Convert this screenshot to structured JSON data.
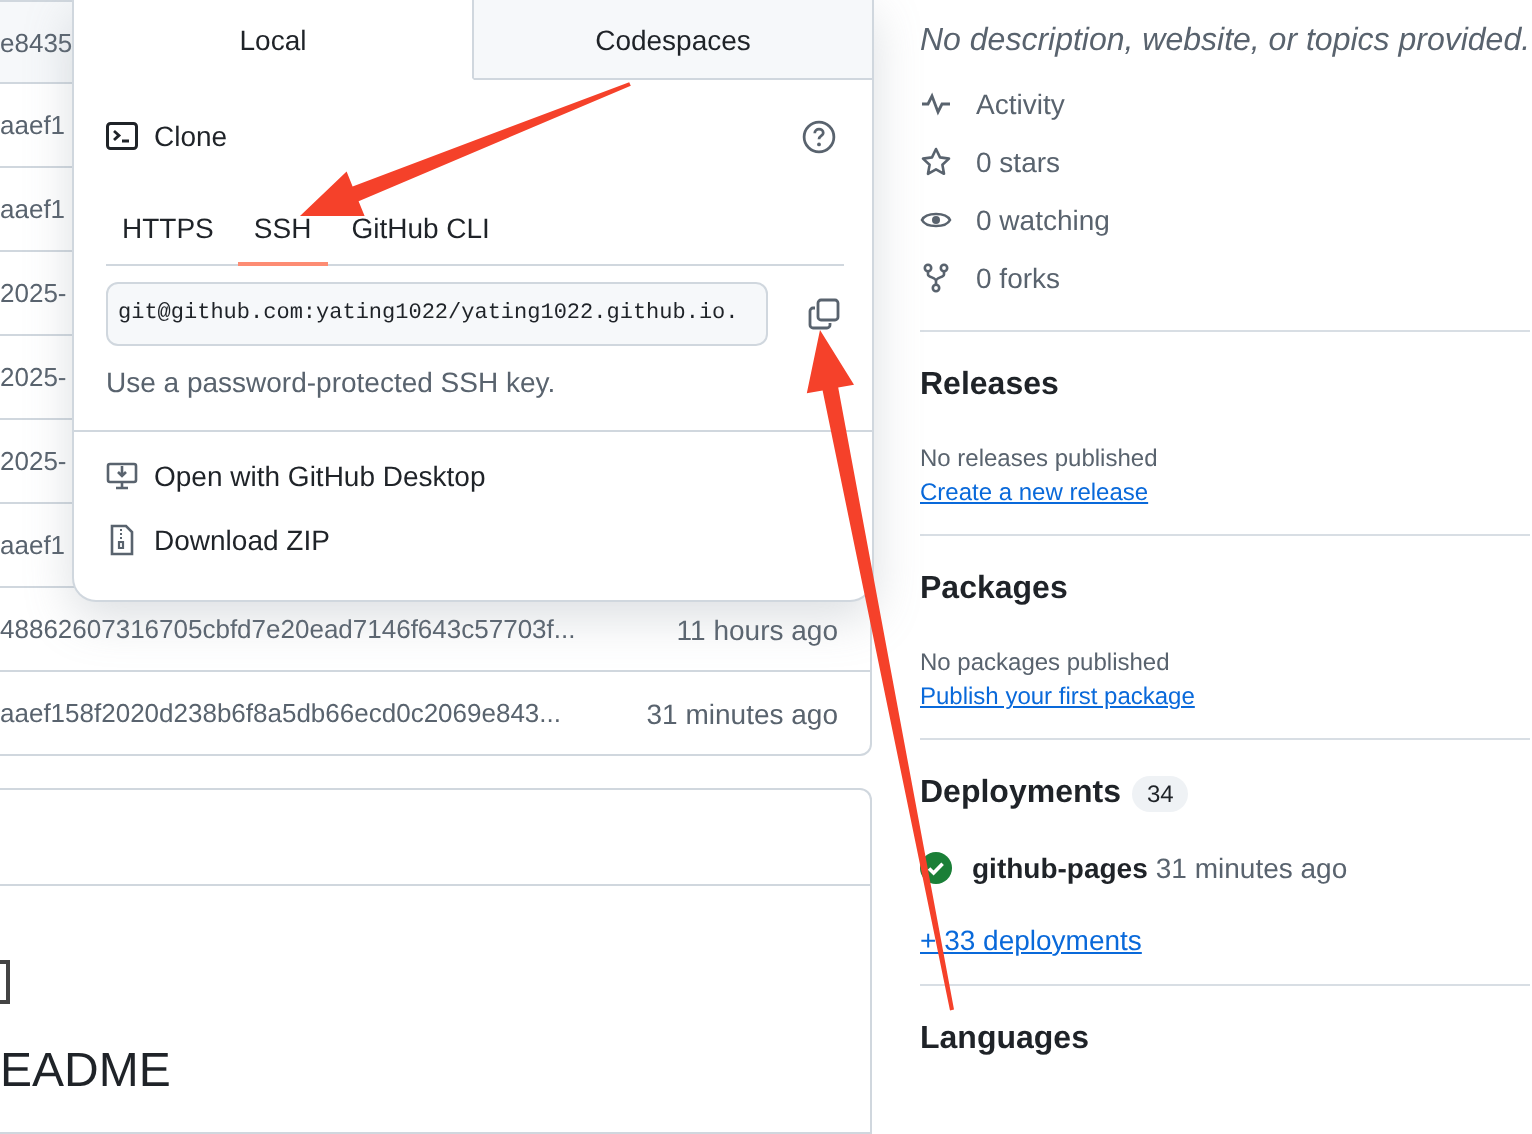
{
  "file_table": {
    "rows": [
      {
        "kind": "header",
        "commit": "e8435"
      },
      {
        "kind": "row",
        "commit": "aaef1"
      },
      {
        "kind": "row",
        "commit": "aaef1"
      },
      {
        "kind": "row",
        "commit": "2025-"
      },
      {
        "kind": "row",
        "commit": "2025-"
      },
      {
        "kind": "row",
        "commit": "2025-"
      },
      {
        "kind": "row",
        "commit": "aaef1"
      },
      {
        "kind": "row",
        "commit": "48862607316705cbfd7e20ead7146f643c57703f...",
        "time": "11 hours ago"
      },
      {
        "kind": "row",
        "commit": "aaef158f2020d238b6f8a5db66ecd0c2069e843...",
        "time": "31 minutes ago"
      }
    ]
  },
  "readme": {
    "heading": "EADME"
  },
  "clone_popup": {
    "tabs": [
      {
        "label": "Local",
        "selected": true
      },
      {
        "label": "Codespaces",
        "selected": false
      }
    ],
    "title": "Clone",
    "protocols": [
      {
        "label": "HTTPS",
        "selected": false
      },
      {
        "label": "SSH",
        "selected": true
      },
      {
        "label": "GitHub CLI",
        "selected": false
      }
    ],
    "url": "git@github.com:yating1022/yating1022.github.io.",
    "hint": "Use a password-protected SSH key.",
    "actions": [
      {
        "kind": "desktop",
        "label": "Open with GitHub Desktop"
      },
      {
        "kind": "zip",
        "label": "Download ZIP"
      }
    ]
  },
  "sidebar": {
    "description": "No description, website, or topics provided.",
    "stats": [
      {
        "kind": "activity",
        "label": "Activity"
      },
      {
        "kind": "stars",
        "label": "0 stars"
      },
      {
        "kind": "watching",
        "label": "0 watching"
      },
      {
        "kind": "forks",
        "label": "0 forks"
      }
    ],
    "releases": {
      "title": "Releases",
      "note": "No releases published",
      "link": "Create a new release"
    },
    "packages": {
      "title": "Packages",
      "note": "No packages published",
      "link": "Publish your first package"
    },
    "deployments": {
      "title": "Deployments",
      "count": "34",
      "items": [
        {
          "name": "github-pages",
          "time": "31 minutes ago"
        }
      ],
      "more": "+ 33 deployments"
    },
    "languages": {
      "title": "Languages"
    }
  }
}
